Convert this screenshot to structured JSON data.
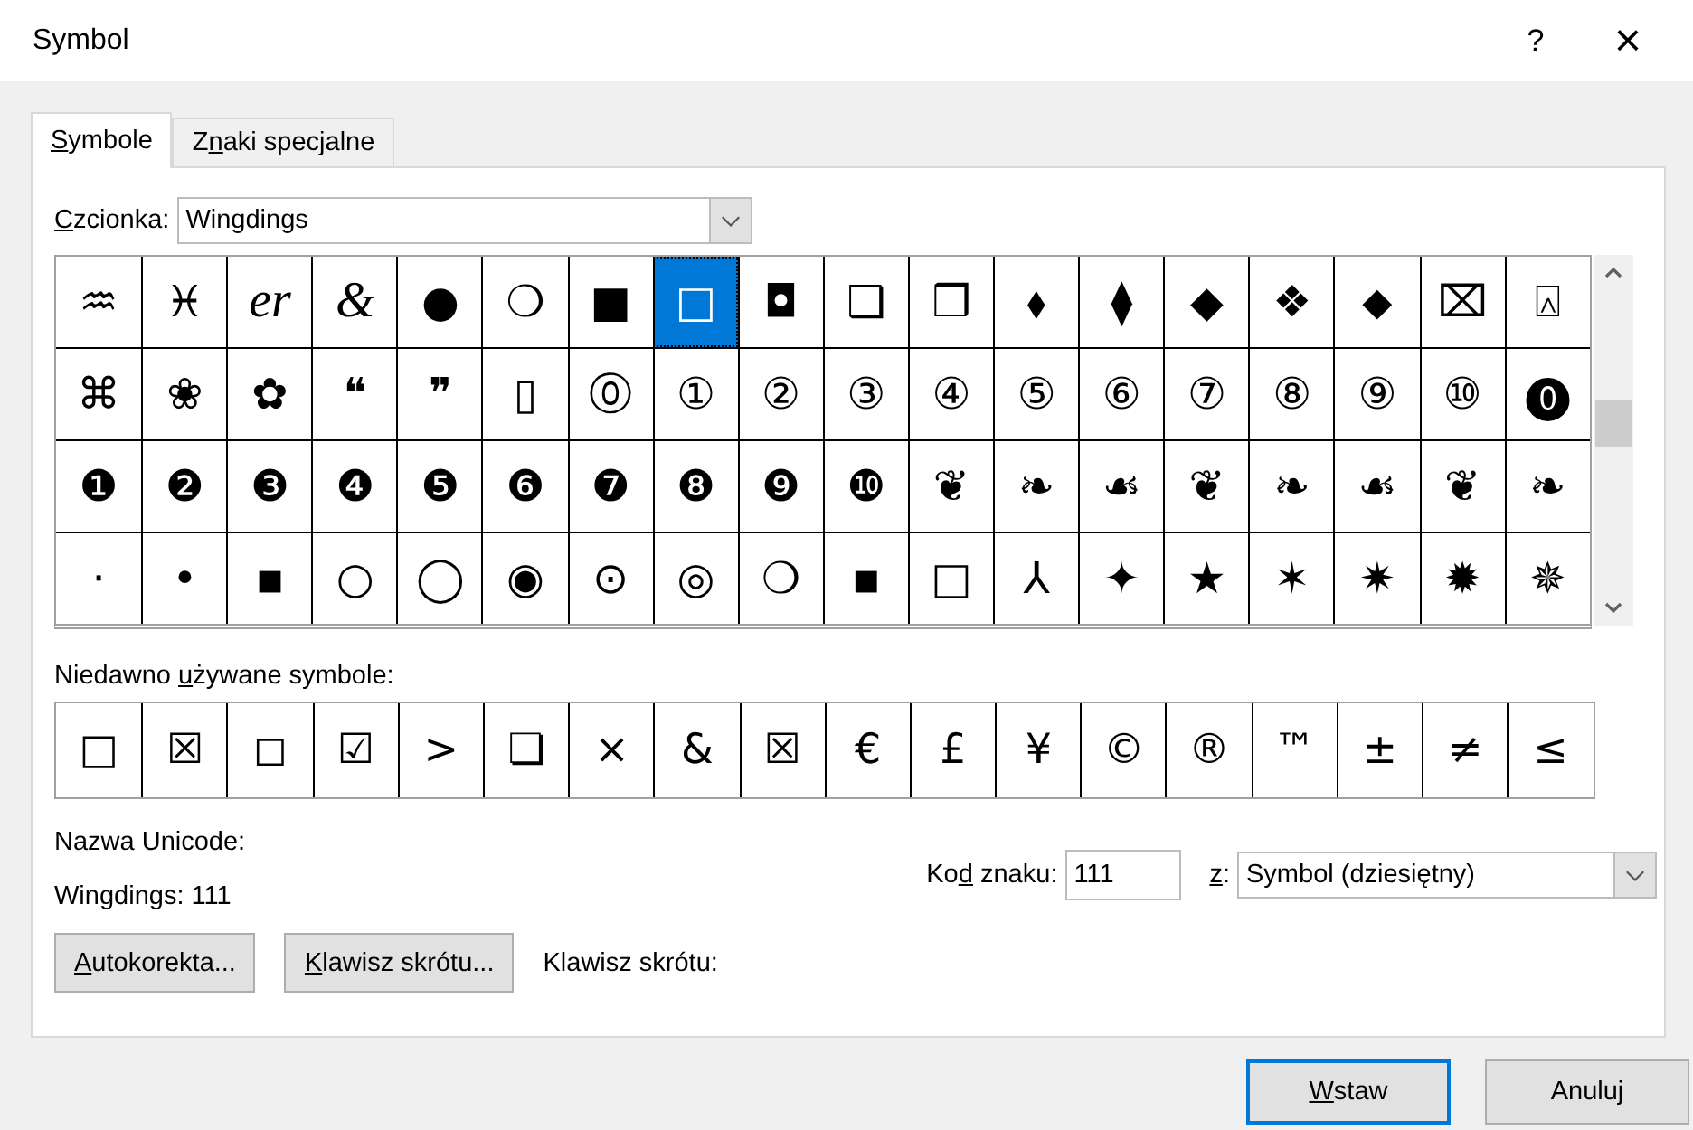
{
  "window": {
    "title": "Symbol",
    "help": "?",
    "close": "×"
  },
  "tabs": [
    {
      "key": "S",
      "post": "ymbole",
      "selected": true
    },
    {
      "pre": "Z",
      "key": "n",
      "post": "aki specjalne",
      "selected": false
    }
  ],
  "font": {
    "key": "C",
    "post": "zcionka:",
    "value": "Wingdings"
  },
  "grid": [
    [
      {
        "char": "♒",
        "selected": false
      },
      {
        "char": "♓",
        "selected": false
      },
      {
        "char": "er",
        "selected": false,
        "kind": "script"
      },
      {
        "char": "&",
        "selected": false,
        "kind": "script"
      },
      {
        "char": "●",
        "selected": false
      },
      {
        "char": "❍",
        "selected": false
      },
      {
        "char": "■",
        "selected": false
      },
      {
        "char": "□",
        "selected": true
      },
      {
        "char": "◘",
        "selected": false
      },
      {
        "char": "❑",
        "selected": false
      },
      {
        "char": "❒",
        "selected": false
      },
      {
        "char": "⬧",
        "selected": false
      },
      {
        "char": "⧫",
        "selected": false
      },
      {
        "char": "◆",
        "selected": false
      },
      {
        "char": "❖",
        "selected": false
      },
      {
        "char": "⬥",
        "selected": false
      },
      {
        "char": "⌧",
        "selected": false
      },
      {
        "char": "⍓",
        "selected": false
      }
    ],
    [
      {
        "char": "⌘",
        "selected": false
      },
      {
        "char": "❀",
        "selected": false
      },
      {
        "char": "✿",
        "selected": false
      },
      {
        "char": "❝",
        "selected": false
      },
      {
        "char": "❞",
        "selected": false
      },
      {
        "char": "▯",
        "selected": false
      },
      {
        "char": "⓪",
        "selected": false
      },
      {
        "char": "①",
        "selected": false
      },
      {
        "char": "②",
        "selected": false
      },
      {
        "char": "③",
        "selected": false
      },
      {
        "char": "④",
        "selected": false
      },
      {
        "char": "⑤",
        "selected": false
      },
      {
        "char": "⑥",
        "selected": false
      },
      {
        "char": "⑦",
        "selected": false
      },
      {
        "char": "⑧",
        "selected": false
      },
      {
        "char": "⑨",
        "selected": false
      },
      {
        "char": "⑩",
        "selected": false
      },
      {
        "char": "⓿",
        "selected": false
      }
    ],
    [
      {
        "char": "❶",
        "selected": false
      },
      {
        "char": "❷",
        "selected": false
      },
      {
        "char": "❸",
        "selected": false
      },
      {
        "char": "❹",
        "selected": false
      },
      {
        "char": "❺",
        "selected": false
      },
      {
        "char": "❻",
        "selected": false
      },
      {
        "char": "❼",
        "selected": false
      },
      {
        "char": "❽",
        "selected": false
      },
      {
        "char": "❾",
        "selected": false
      },
      {
        "char": "❿",
        "selected": false
      },
      {
        "char": "❦",
        "selected": false
      },
      {
        "char": "❧",
        "selected": false
      },
      {
        "char": "☙",
        "selected": false
      },
      {
        "char": "❦",
        "selected": false
      },
      {
        "char": "❧",
        "selected": false
      },
      {
        "char": "☙",
        "selected": false
      },
      {
        "char": "❦",
        "selected": false
      },
      {
        "char": "❧",
        "selected": false
      }
    ],
    [
      {
        "char": "·",
        "selected": false
      },
      {
        "char": "•",
        "selected": false
      },
      {
        "char": "▪",
        "selected": false
      },
      {
        "char": "○",
        "selected": false
      },
      {
        "char": "◯",
        "selected": false
      },
      {
        "char": "◉",
        "selected": false
      },
      {
        "char": "⊙",
        "selected": false
      },
      {
        "char": "◎",
        "selected": false
      },
      {
        "char": "❍",
        "selected": false
      },
      {
        "char": "▪",
        "selected": false
      },
      {
        "char": "□",
        "selected": false
      },
      {
        "char": "⅄",
        "selected": false
      },
      {
        "char": "✦",
        "selected": false
      },
      {
        "char": "★",
        "selected": false
      },
      {
        "char": "✶",
        "selected": false
      },
      {
        "char": "✷",
        "selected": false
      },
      {
        "char": "✹",
        "selected": false
      },
      {
        "char": "✵",
        "selected": false
      }
    ]
  ],
  "recent": {
    "pre": "Niedawno ",
    "key": "u",
    "post": "żywane symbole:",
    "symbols": [
      "□",
      "☒",
      "◻",
      "☑",
      ">",
      "❏",
      "×",
      "&",
      "☒",
      "€",
      "£",
      "¥",
      "©",
      "®",
      "™",
      "±",
      "≠",
      "≤"
    ]
  },
  "unicode_name": {
    "label": "Nazwa Unicode:",
    "value": "Wingdings: 111"
  },
  "char_code": {
    "pre": "Ko",
    "key": "d",
    "post": " znaku:",
    "value": "111"
  },
  "from": {
    "key": "z",
    "post": ":",
    "value": "Symbol (dziesiętny)"
  },
  "buttons": [
    {
      "key": "A",
      "post": "utokorekta..."
    },
    {
      "key": "K",
      "post": "lawisz skrótu..."
    }
  ],
  "shortcut_label": "Klawisz skrótu:",
  "footer": [
    {
      "key": "W",
      "post": "staw",
      "default": true
    },
    {
      "pre": "Anuluj",
      "default": false
    }
  ]
}
